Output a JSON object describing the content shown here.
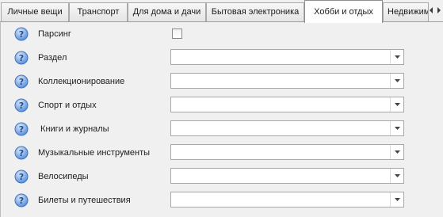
{
  "tabs": [
    {
      "label": "Личные вещи",
      "active": false
    },
    {
      "label": "Транспорт",
      "active": false
    },
    {
      "label": "Для дома и дачи",
      "active": false
    },
    {
      "label": "Бытовая электроника",
      "active": false
    },
    {
      "label": "Хобби и отдых",
      "active": true
    },
    {
      "label": "Недвижим",
      "active": false
    }
  ],
  "form": {
    "parsing": {
      "label": "Парсинг",
      "checked": false
    },
    "fields": [
      {
        "label": "Раздел",
        "value": ""
      },
      {
        "label": "Коллекционирование",
        "value": ""
      },
      {
        "label": "Спорт и отдых",
        "value": ""
      },
      {
        "label": " Книги и журналы",
        "value": ""
      },
      {
        "label": "Музыкальные инструменты",
        "value": ""
      },
      {
        "label": "Велосипеды",
        "value": ""
      },
      {
        "label": "Билеты и путешествия",
        "value": ""
      }
    ]
  },
  "icons": {
    "help": "question-mark-icon",
    "dropdown": "chevron-down-icon",
    "tab_scroll_left": "arrow-left-icon",
    "tab_scroll_right": "arrow-right-icon"
  },
  "colors": {
    "help_icon_blue": "#3f74c4",
    "help_icon_light": "#a9c7f0",
    "panel_background": "#f0f0f0",
    "active_tab_background": "#ffffff"
  }
}
